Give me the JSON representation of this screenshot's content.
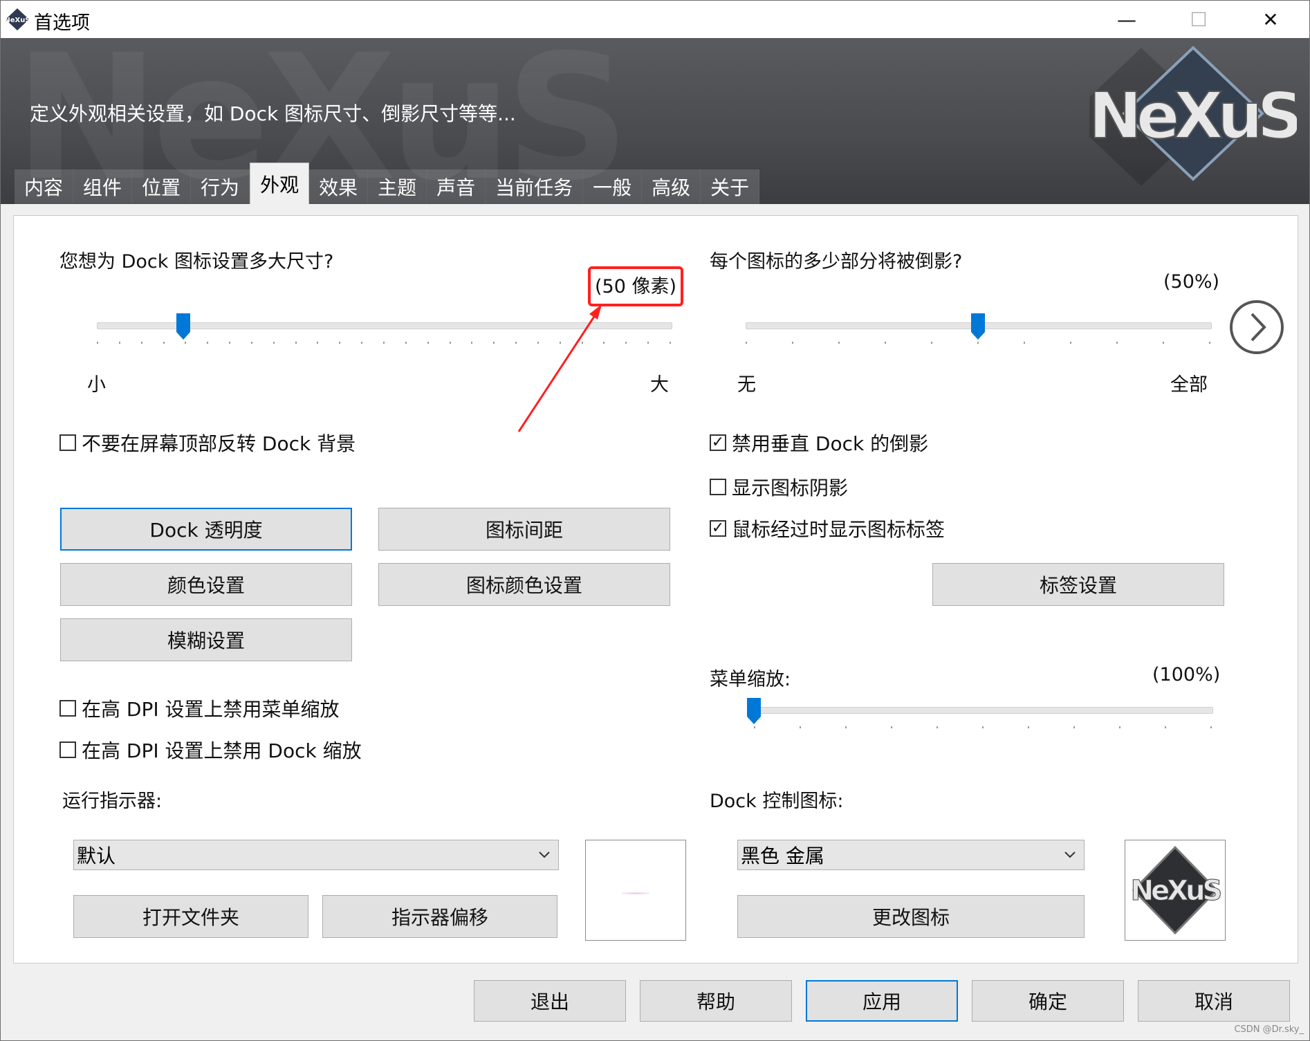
{
  "window": {
    "title": "首选项",
    "minimize": "—",
    "maximize": "☐",
    "close": "✕"
  },
  "banner": {
    "description": "定义外观相关设置，如 Dock 图标尺寸、倒影尺寸等等...",
    "logo_text": "NeXuS",
    "tabs": [
      "内容",
      "组件",
      "位置",
      "行为",
      "外观",
      "效果",
      "主题",
      "声音",
      "当前任务",
      "一般",
      "高级",
      "关于"
    ],
    "active_tab": "外观"
  },
  "icon_size": {
    "question": "您想为 Dock 图标设置多大尺寸?",
    "value_label": "(50 像素)",
    "value_fraction": 0.15,
    "min_label": "小",
    "max_label": "大"
  },
  "reflection": {
    "question": "每个图标的多少部分将被倒影?",
    "value_label": "(50%)",
    "value_fraction": 0.5,
    "min_label": "无",
    "max_label": "全部"
  },
  "checkboxes_left": {
    "no_flip": {
      "label": "不要在屏幕顶部反转 Dock 背景",
      "checked": false
    },
    "dpi_menu": {
      "label": "在高 DPI 设置上禁用菜单缩放",
      "checked": false
    },
    "dpi_dock": {
      "label": "在高 DPI 设置上禁用 Dock 缩放",
      "checked": false
    }
  },
  "checkboxes_right": {
    "vertical_reflection": {
      "label": "禁用垂直 Dock 的倒影",
      "checked": true
    },
    "icon_shadow": {
      "label": "显示图标阴影",
      "checked": false
    },
    "hover_label": {
      "label": "鼠标经过时显示图标标签",
      "checked": true
    }
  },
  "buttons": {
    "dock_opacity": "Dock 透明度",
    "icon_spacing": "图标间距",
    "color_settings": "颜色设置",
    "icon_color_settings": "图标颜色设置",
    "blur_settings": "模糊设置",
    "label_settings": "标签设置",
    "open_folder": "打开文件夹",
    "indicator_offset": "指示器偏移",
    "change_icon": "更改图标"
  },
  "menu_scale": {
    "label": "菜单缩放:",
    "value_label": "(100%)",
    "value_fraction": 0.0
  },
  "running_indicator": {
    "label": "运行指示器:",
    "selected": "默认"
  },
  "dock_control_icon": {
    "label": "Dock 控制图标:",
    "selected": "黑色 金属"
  },
  "footer": {
    "exit": "退出",
    "help": "帮助",
    "apply": "应用",
    "ok": "确定",
    "cancel": "取消"
  },
  "watermark": "CSDN @Dr.sky_",
  "colors": {
    "accent": "#0078d7",
    "annotation": "#ff2020",
    "banner": "#4f5054"
  }
}
